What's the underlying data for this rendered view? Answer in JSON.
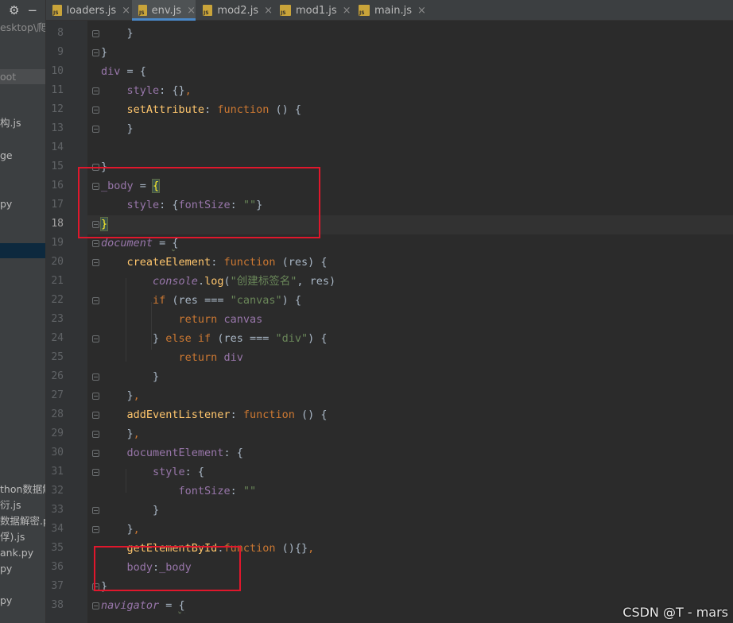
{
  "project_panel": {
    "toolbar": {
      "settings_icon": "gear-icon",
      "collapse_icon": "minus-icon"
    },
    "items": [
      {
        "label": "esktop\\爬",
        "muted": true
      },
      {
        "label": "oot",
        "muted": true
      },
      {
        "label": "构.js"
      },
      {
        "label": "ge"
      },
      {
        "label": "py"
      },
      {
        "label": "thon数据解"
      },
      {
        "label": "衍.js"
      },
      {
        "label": "数据解密.py"
      },
      {
        "label": "俘).js"
      },
      {
        "label": "ank.py"
      },
      {
        "label": "py"
      },
      {
        "label": "py"
      }
    ]
  },
  "tabs": [
    {
      "label": "loaders.js",
      "active": false
    },
    {
      "label": "env.js",
      "active": true
    },
    {
      "label": "mod2.js",
      "active": false
    },
    {
      "label": "mod1.js",
      "active": false
    },
    {
      "label": "main.js",
      "active": false
    }
  ],
  "tab_icon_text": "JS",
  "tab_close_glyph": "×",
  "editor": {
    "current_line": "18",
    "lines": [
      {
        "n": "8",
        "segs": [
          {
            "t": "    }",
            "c": ""
          }
        ]
      },
      {
        "n": "9",
        "segs": [
          {
            "t": "}",
            "c": ""
          }
        ]
      },
      {
        "n": "10",
        "segs": [
          {
            "t": "div",
            "c": "pp"
          },
          {
            "t": " = {",
            "c": ""
          }
        ]
      },
      {
        "n": "11",
        "segs": [
          {
            "t": "    ",
            "c": ""
          },
          {
            "t": "style",
            "c": "pp"
          },
          {
            "t": ": {}",
            "c": ""
          },
          {
            "t": ",",
            "c": "kw"
          }
        ]
      },
      {
        "n": "12",
        "segs": [
          {
            "t": "    ",
            "c": ""
          },
          {
            "t": "setAttribute",
            "c": "prop"
          },
          {
            "t": ": ",
            "c": ""
          },
          {
            "t": "function",
            "c": "kw"
          },
          {
            "t": " () {",
            "c": ""
          }
        ]
      },
      {
        "n": "13",
        "segs": [
          {
            "t": "    }",
            "c": ""
          }
        ]
      },
      {
        "n": "14",
        "segs": [
          {
            "t": "",
            "c": ""
          }
        ]
      },
      {
        "n": "15",
        "segs": [
          {
            "t": "}",
            "c": ""
          }
        ]
      },
      {
        "n": "16",
        "segs": [
          {
            "t": "_body",
            "c": "pp"
          },
          {
            "t": " = ",
            "c": ""
          },
          {
            "t": "{",
            "c": "brace-hl"
          }
        ]
      },
      {
        "n": "17",
        "segs": [
          {
            "t": "    ",
            "c": ""
          },
          {
            "t": "style",
            "c": "pp"
          },
          {
            "t": ": {",
            "c": ""
          },
          {
            "t": "fontSize",
            "c": "pp"
          },
          {
            "t": ": ",
            "c": ""
          },
          {
            "t": "\"\"",
            "c": "str"
          },
          {
            "t": "}",
            "c": ""
          }
        ]
      },
      {
        "n": "18",
        "segs": [
          {
            "t": "}",
            "c": "brace-hl"
          }
        ]
      },
      {
        "n": "19",
        "segs": [
          {
            "t": "document",
            "c": "g"
          },
          {
            "t": " = ",
            "c": ""
          },
          {
            "t": "{",
            "c": "sq-under"
          }
        ]
      },
      {
        "n": "20",
        "segs": [
          {
            "t": "    ",
            "c": ""
          },
          {
            "t": "createElement",
            "c": "prop"
          },
          {
            "t": ": ",
            "c": ""
          },
          {
            "t": "function",
            "c": "kw"
          },
          {
            "t": " (res) {",
            "c": ""
          }
        ]
      },
      {
        "n": "21",
        "segs": [
          {
            "t": "        ",
            "c": ""
          },
          {
            "t": "console",
            "c": "g"
          },
          {
            "t": ".",
            "c": ""
          },
          {
            "t": "log",
            "c": "prop"
          },
          {
            "t": "(",
            "c": ""
          },
          {
            "t": "\"创建标签名\"",
            "c": "str"
          },
          {
            "t": ", res)",
            "c": ""
          }
        ]
      },
      {
        "n": "22",
        "segs": [
          {
            "t": "        ",
            "c": ""
          },
          {
            "t": "if",
            "c": "kw"
          },
          {
            "t": " (res === ",
            "c": ""
          },
          {
            "t": "\"canvas\"",
            "c": "str"
          },
          {
            "t": ") {",
            "c": ""
          }
        ]
      },
      {
        "n": "23",
        "segs": [
          {
            "t": "            ",
            "c": ""
          },
          {
            "t": "return",
            "c": "kw"
          },
          {
            "t": " ",
            "c": ""
          },
          {
            "t": "canvas",
            "c": "pp"
          }
        ]
      },
      {
        "n": "24",
        "segs": [
          {
            "t": "        } ",
            "c": ""
          },
          {
            "t": "else if",
            "c": "kw"
          },
          {
            "t": " (res === ",
            "c": ""
          },
          {
            "t": "\"div\"",
            "c": "str"
          },
          {
            "t": ") {",
            "c": ""
          }
        ]
      },
      {
        "n": "25",
        "segs": [
          {
            "t": "            ",
            "c": ""
          },
          {
            "t": "return",
            "c": "kw"
          },
          {
            "t": " ",
            "c": ""
          },
          {
            "t": "div",
            "c": "pp"
          }
        ]
      },
      {
        "n": "26",
        "segs": [
          {
            "t": "        }",
            "c": ""
          }
        ]
      },
      {
        "n": "27",
        "segs": [
          {
            "t": "    }",
            "c": ""
          },
          {
            "t": ",",
            "c": "kw"
          }
        ]
      },
      {
        "n": "28",
        "segs": [
          {
            "t": "    ",
            "c": ""
          },
          {
            "t": "addEventListener",
            "c": "prop"
          },
          {
            "t": ": ",
            "c": ""
          },
          {
            "t": "function",
            "c": "kw"
          },
          {
            "t": " () {",
            "c": ""
          }
        ]
      },
      {
        "n": "29",
        "segs": [
          {
            "t": "    }",
            "c": ""
          },
          {
            "t": ",",
            "c": "kw"
          }
        ]
      },
      {
        "n": "30",
        "segs": [
          {
            "t": "    ",
            "c": ""
          },
          {
            "t": "documentElement",
            "c": "pp"
          },
          {
            "t": ": {",
            "c": ""
          }
        ]
      },
      {
        "n": "31",
        "segs": [
          {
            "t": "        ",
            "c": ""
          },
          {
            "t": "style",
            "c": "pp"
          },
          {
            "t": ": {",
            "c": ""
          }
        ]
      },
      {
        "n": "32",
        "segs": [
          {
            "t": "            ",
            "c": ""
          },
          {
            "t": "fontSize",
            "c": "pp"
          },
          {
            "t": ": ",
            "c": ""
          },
          {
            "t": "\"\"",
            "c": "str"
          }
        ]
      },
      {
        "n": "33",
        "segs": [
          {
            "t": "        }",
            "c": ""
          }
        ]
      },
      {
        "n": "34",
        "segs": [
          {
            "t": "    }",
            "c": ""
          },
          {
            "t": ",",
            "c": "kw"
          }
        ]
      },
      {
        "n": "35",
        "segs": [
          {
            "t": "    ",
            "c": ""
          },
          {
            "t": "getElementById",
            "c": "prop"
          },
          {
            "t": ":",
            "c": ""
          },
          {
            "t": "function",
            "c": "kw"
          },
          {
            "t": " (){}",
            "c": ""
          },
          {
            "t": ",",
            "c": "kw"
          }
        ]
      },
      {
        "n": "36",
        "segs": [
          {
            "t": "    ",
            "c": ""
          },
          {
            "t": "body",
            "c": "pp"
          },
          {
            "t": ":",
            "c": ""
          },
          {
            "t": "_body",
            "c": "pp"
          }
        ]
      },
      {
        "n": "37",
        "segs": [
          {
            "t": "}",
            "c": ""
          }
        ]
      },
      {
        "n": "38",
        "segs": [
          {
            "t": "navigator",
            "c": "g"
          },
          {
            "t": " = ",
            "c": ""
          },
          {
            "t": "{",
            "c": "sq-under"
          }
        ]
      }
    ]
  },
  "watermark": "CSDN @T - mars",
  "colors": {
    "annotation_red": "#e0172c",
    "active_tab_underline": "#4a88c7"
  }
}
